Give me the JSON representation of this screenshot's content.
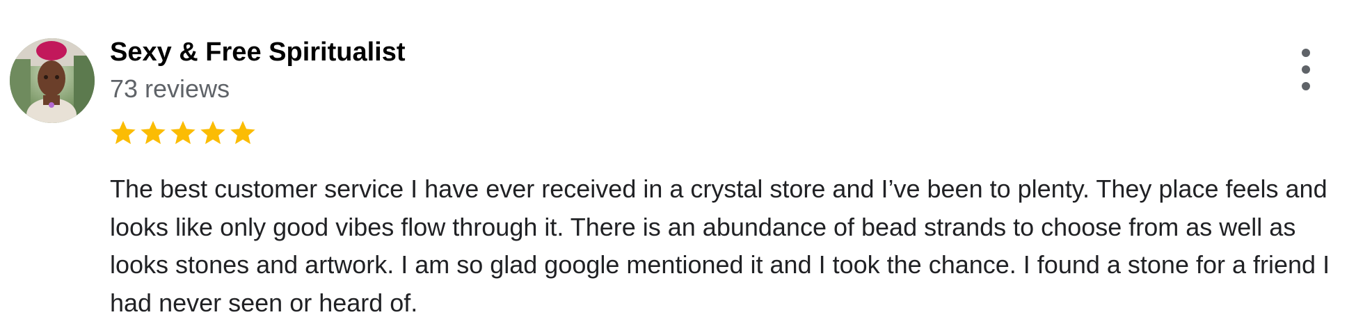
{
  "review": {
    "author": "Sexy & Free Spiritualist",
    "review_count": "73 reviews",
    "rating": 5,
    "rating_max": 5,
    "star_color": "#fbbc04",
    "text": "The best customer service I have ever received in a crystal store and I’ve been to plenty. They place feels and looks like only good vibes flow through it. There is an abundance of bead strands to choose from as well as looks stones and artwork. I am so glad google mentioned it and I took the chance. I found a stone for a friend I had never seen or heard of.",
    "avatar_icon": "user-photo",
    "menu_icon": "more-vert-icon"
  }
}
